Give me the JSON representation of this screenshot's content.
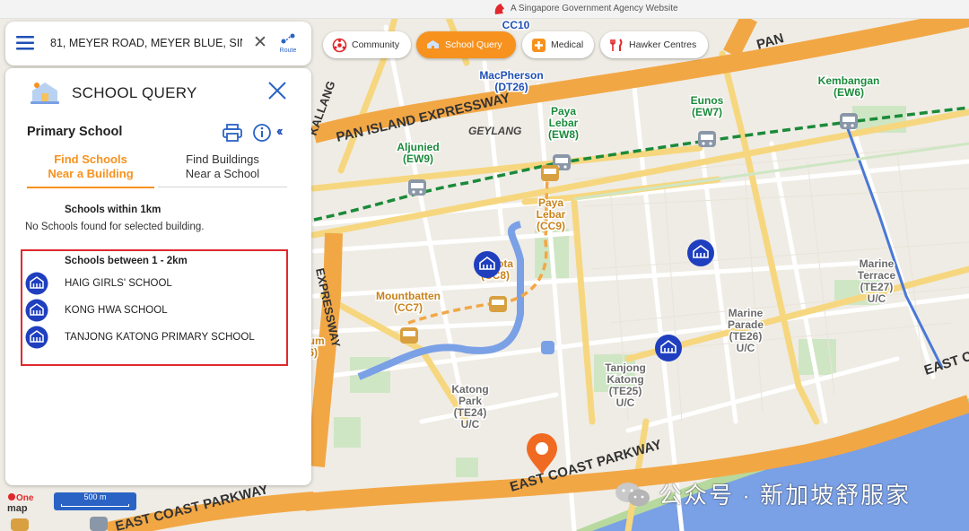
{
  "gov_banner": "A Singapore Government Agency Website",
  "search": {
    "address": "81, MEYER ROAD, MEYER BLUE, SINGAPORE",
    "route_label": "Route"
  },
  "chips": [
    {
      "label": "Community",
      "active": false
    },
    {
      "label": "School Query",
      "active": true
    },
    {
      "label": "Medical",
      "active": false
    },
    {
      "label": "Hawker Centres",
      "active": false
    }
  ],
  "panel": {
    "title": "SCHOOL QUERY",
    "subtitle": "Primary School",
    "tabs": [
      {
        "line1": "Find Schools",
        "line2": "Near a Building",
        "active": true
      },
      {
        "line1": "Find Buildings",
        "line2": "Near a School",
        "active": false
      }
    ],
    "within_heading": "Schools within 1km",
    "within_empty": "No Schools found for selected building.",
    "between_heading": "Schools between 1 - 2km",
    "schools": [
      "HAIG GIRLS' SCHOOL",
      "KONG HWA SCHOOL",
      "TANJONG KATONG PRIMARY SCHOOL"
    ]
  },
  "map_labels": {
    "roads": [
      "PAN ISLAND EXPRESSWAY",
      "EAST COAST PARKWAY",
      "EAST COAST PARKWAY",
      "EAST COAST PARKWAY",
      "PAN",
      "KALLANG",
      "EXPRESSWAY",
      "EAST CO"
    ],
    "areas": [
      "GEYLANG"
    ],
    "stations": [
      {
        "name": "CC10"
      },
      {
        "name": "MacPherson",
        "code": "(DT26)"
      },
      {
        "name": "Eunos",
        "code": "(EW7)"
      },
      {
        "name": "Kembangan",
        "code": "(EW6)"
      },
      {
        "name": "Paya",
        "line2": "Lebar",
        "code": "(EW8)"
      },
      {
        "name": "Aljunied",
        "code": "(EW9)"
      },
      {
        "name": "Paya",
        "line2": "Lebar",
        "code": "(CC9)"
      },
      {
        "name": "Dakota",
        "code": "(CC8)"
      },
      {
        "name": "Mountbatten",
        "code": "(CC7)"
      },
      {
        "name": "Marine",
        "line2": "Terrace",
        "code": "(TE27)",
        "extra": "U/C"
      },
      {
        "name": "Marine",
        "line2": "Parade",
        "code": "(TE26)",
        "extra": "U/C"
      },
      {
        "name": "Tanjong",
        "line2": "Katong",
        "code": "(TE25)",
        "extra": "U/C"
      },
      {
        "name": "Katong",
        "line2": "Park",
        "code": "(TE24)",
        "extra": "U/C"
      },
      {
        "name": "Stadium",
        "code": "(CC6)"
      }
    ]
  },
  "scale_label": "500 m",
  "logo_text": {
    "line1": "One",
    "line2": "map"
  },
  "watermark": "公众号 · 新加坡舒服家",
  "colors": {
    "accent": "#f7921e",
    "brand_blue": "#1f4fb5",
    "highlight": "#e0282d",
    "marker": "#f06a22",
    "mrt_green": "#1b8a3a"
  }
}
